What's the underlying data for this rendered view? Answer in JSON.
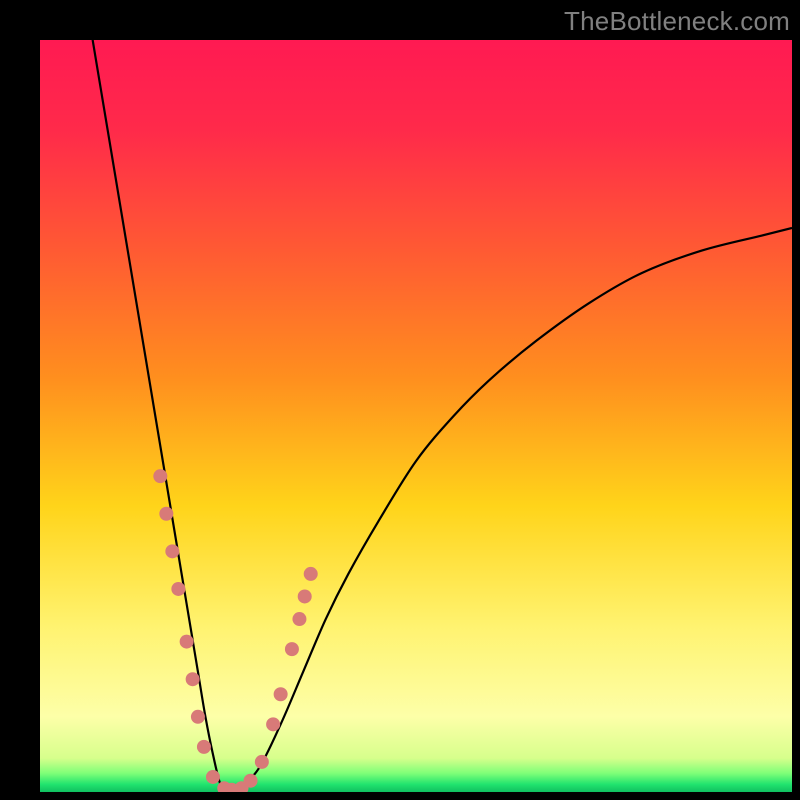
{
  "watermark": "TheBottleneck.com",
  "chart_data": {
    "type": "line",
    "title": "",
    "xlabel": "",
    "ylabel": "",
    "xlim": [
      0,
      100
    ],
    "ylim": [
      0,
      100
    ],
    "gradient_stops": [
      {
        "pos": 0.0,
        "color": "#ff1a52"
      },
      {
        "pos": 0.12,
        "color": "#ff2a4a"
      },
      {
        "pos": 0.28,
        "color": "#ff5a33"
      },
      {
        "pos": 0.45,
        "color": "#ff8f1e"
      },
      {
        "pos": 0.62,
        "color": "#ffd41a"
      },
      {
        "pos": 0.78,
        "color": "#fff370"
      },
      {
        "pos": 0.9,
        "color": "#fdffa8"
      },
      {
        "pos": 0.955,
        "color": "#d7ff8c"
      },
      {
        "pos": 0.975,
        "color": "#7fff78"
      },
      {
        "pos": 0.99,
        "color": "#20e36e"
      },
      {
        "pos": 1.0,
        "color": "#10c060"
      }
    ],
    "series": [
      {
        "name": "bottleneck-curve",
        "x": [
          7,
          8,
          9,
          10,
          11,
          12,
          13,
          14,
          15,
          16,
          17,
          18,
          19,
          20,
          21,
          22,
          23,
          24,
          25,
          26,
          29,
          32,
          35,
          38,
          41,
          45,
          50,
          55,
          60,
          66,
          73,
          80,
          88,
          96,
          100
        ],
        "y": [
          100,
          94,
          88,
          82,
          76,
          70,
          64,
          58,
          52,
          46,
          40,
          34,
          28,
          22,
          16,
          10,
          5,
          1,
          0,
          0,
          3,
          9,
          16,
          23,
          29,
          36,
          44,
          50,
          55,
          60,
          65,
          69,
          72,
          74,
          75
        ]
      }
    ],
    "markers": {
      "name": "gpu-sample-points",
      "color": "#d87a78",
      "radius_px": 7,
      "points": [
        {
          "x": 16.0,
          "y": 42
        },
        {
          "x": 16.8,
          "y": 37
        },
        {
          "x": 17.6,
          "y": 32
        },
        {
          "x": 18.4,
          "y": 27
        },
        {
          "x": 19.5,
          "y": 20
        },
        {
          "x": 20.3,
          "y": 15
        },
        {
          "x": 21.0,
          "y": 10
        },
        {
          "x": 21.8,
          "y": 6
        },
        {
          "x": 23.0,
          "y": 2
        },
        {
          "x": 24.5,
          "y": 0.5
        },
        {
          "x": 25.5,
          "y": 0.3
        },
        {
          "x": 26.8,
          "y": 0.5
        },
        {
          "x": 28.0,
          "y": 1.5
        },
        {
          "x": 29.5,
          "y": 4
        },
        {
          "x": 31.0,
          "y": 9
        },
        {
          "x": 32.0,
          "y": 13
        },
        {
          "x": 33.5,
          "y": 19
        },
        {
          "x": 34.5,
          "y": 23
        },
        {
          "x": 35.2,
          "y": 26
        },
        {
          "x": 36.0,
          "y": 29
        }
      ]
    }
  }
}
